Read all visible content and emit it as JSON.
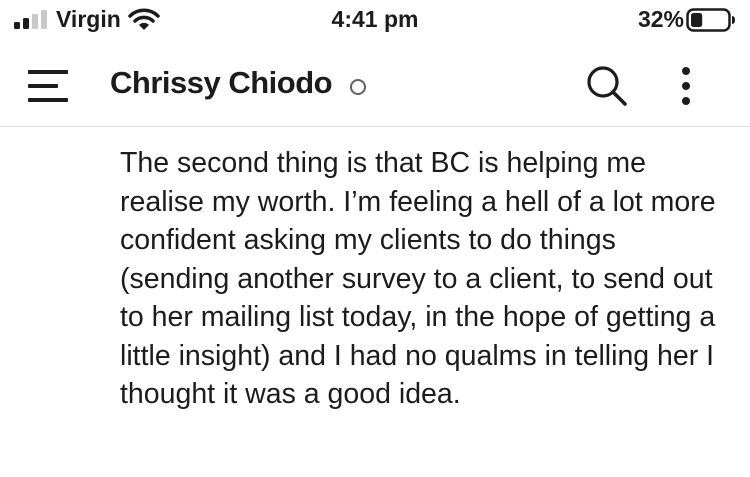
{
  "status_bar": {
    "carrier": "Virgin",
    "time": "4:41 pm",
    "battery_percent": "32%",
    "battery_level": 0.32,
    "signal_bars": 2,
    "signal_icon": "cellular-signal-icon",
    "wifi_icon": "wifi-icon",
    "battery_icon": "battery-icon"
  },
  "header": {
    "title": "Chrissy Chiodo",
    "presence": "away",
    "menu_icon": "hamburger-menu-icon",
    "search_icon": "search-icon",
    "more_icon": "vertical-ellipsis-icon"
  },
  "message": {
    "text": "The second thing is that BC is helping me realise my worth. I’m feeling a hell of a lot more confident asking my clients to do things (sending another survey to a client, to send out to her mailing list today, in the hope of getting a little insight) and I had no qualms in telling her I thought it was a good idea."
  },
  "colors": {
    "text": "#1d1c1d",
    "divider": "#dddddd",
    "muted": "#616061",
    "background": "#ffffff"
  }
}
